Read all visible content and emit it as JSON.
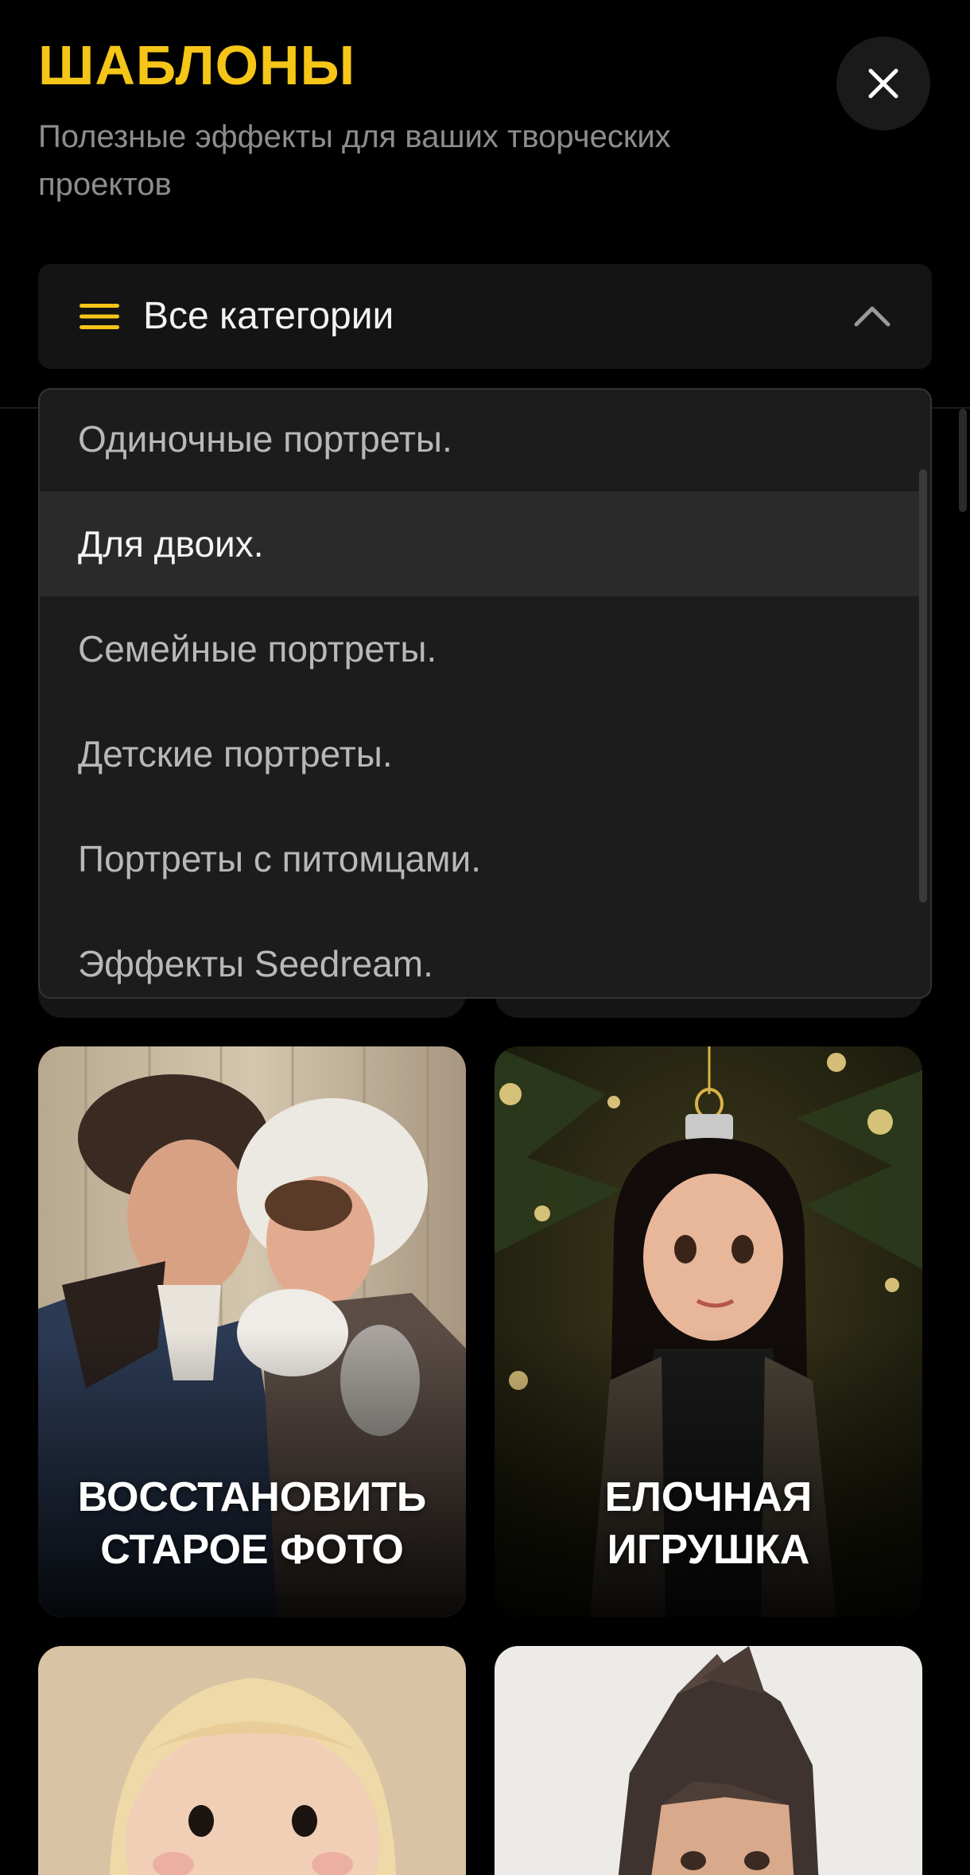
{
  "header": {
    "title": "ШАБЛОНЫ",
    "subtitle": "Полезные эффекты для ваших творческих проектов",
    "close_icon": "close-icon"
  },
  "category_select": {
    "label": "Все категории",
    "menu_icon": "hamburger-icon",
    "chevron_icon": "chevron-up-icon",
    "expanded": true
  },
  "dropdown": {
    "items": [
      {
        "label": "Одиночные портреты."
      },
      {
        "label": "Для двоих.",
        "active": true
      },
      {
        "label": "Семейные портреты."
      },
      {
        "label": "Детские портреты."
      },
      {
        "label": "Портреты с питомцами."
      },
      {
        "label": "Эффекты Seedream."
      }
    ]
  },
  "cards": [
    {
      "line1": "ВОССТАНОВИТЬ",
      "line2": "СТАРОЕ ФОТО"
    },
    {
      "line1": "ЕЛОЧНАЯ",
      "line2": "ИГРУШКА"
    },
    {
      "line1": "",
      "line2": ""
    },
    {
      "line1": "",
      "line2": ""
    }
  ],
  "colors": {
    "accent": "#F5C518",
    "background": "#000000",
    "surface": "#141414",
    "dropdown_bg": "#1C1C1D",
    "dropdown_active": "#2A2A2B"
  }
}
